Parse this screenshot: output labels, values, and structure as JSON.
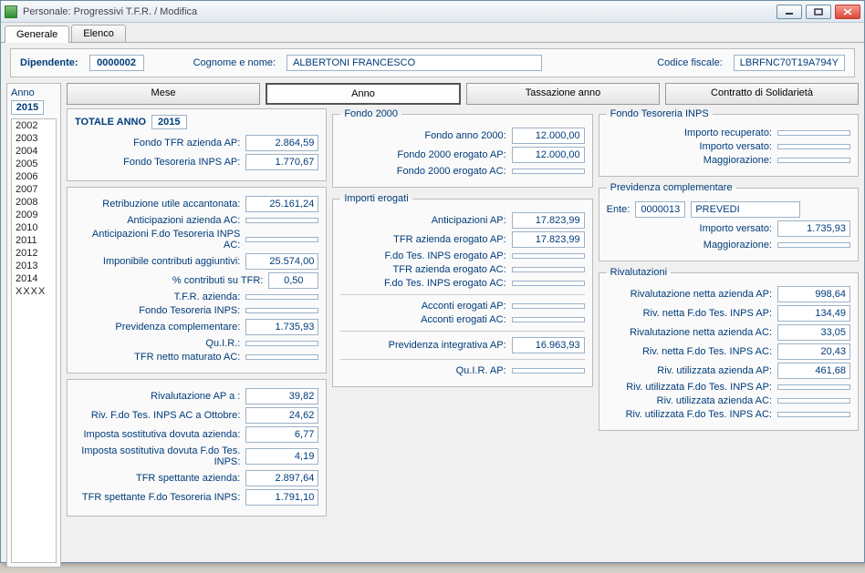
{
  "window": {
    "title": "Personale: Progressivi T.F.R. / Modifica"
  },
  "tabs": {
    "generale": "Generale",
    "elenco": "Elenco"
  },
  "header": {
    "dipendente_lbl": "Dipendente:",
    "dipendente_val": "0000002",
    "cognome_lbl": "Cognome e nome:",
    "cognome_val": "ALBERTONI FRANCESCO",
    "cf_lbl": "Codice fiscale:",
    "cf_val": "LBRFNC70T19A794Y"
  },
  "anno": {
    "label": "Anno",
    "value": "2015"
  },
  "years": [
    "2002",
    "2003",
    "2004",
    "2005",
    "2006",
    "2007",
    "2008",
    "2009",
    "2010",
    "2011",
    "2012",
    "2013",
    "2014"
  ],
  "years_edit_placeholder": "XXXX",
  "subtabs": {
    "mese": "Mese",
    "anno": "Anno",
    "tass": "Tassazione anno",
    "contratto": "Contratto di Solidarietà"
  },
  "totale_anno": {
    "label": "TOTALE ANNO",
    "year": "2015"
  },
  "col1a": {
    "fondo_tfr_az_ap": {
      "lab": "Fondo TFR azienda AP:",
      "val": "2.864,59"
    },
    "fondo_tes_inps_ap": {
      "lab": "Fondo Tesoreria INPS AP:",
      "val": "1.770,67"
    }
  },
  "col1b": {
    "retrib": {
      "lab": "Retribuzione utile accantonata:",
      "val": "25.161,24"
    },
    "anticip_az_ac": {
      "lab": "Anticipazioni azienda AC:",
      "val": ""
    },
    "anticip_fdo_ac": {
      "lab": "Anticipazioni F.do Tesoreria INPS AC:",
      "val": ""
    },
    "impon_contr": {
      "lab": "Imponibile contributi aggiuntivi:",
      "val": "25.574,00"
    },
    "perc_contr": {
      "lab": "% contributi su TFR:",
      "val": "0,50"
    },
    "tfr_az": {
      "lab": "T.F.R. azienda:",
      "val": ""
    },
    "fondo_tes_inps": {
      "lab": "Fondo Tesoreria INPS:",
      "val": ""
    },
    "prev_compl": {
      "lab": "Previdenza complementare:",
      "val": "1.735,93"
    },
    "quir": {
      "lab": "Qu.I.R.:",
      "val": ""
    },
    "tfr_netto": {
      "lab": "TFR netto maturato AC:",
      "val": ""
    }
  },
  "col1c": {
    "riv_ap": {
      "lab": "Rivalutazione AP a :",
      "val": "39,82"
    },
    "riv_fdo_ac_ott": {
      "lab": "Riv. F.do Tes. INPS AC a Ottobre:",
      "val": "24,62"
    },
    "imp_sost_az": {
      "lab": "Imposta sostitutiva dovuta azienda:",
      "val": "6,77"
    },
    "imp_sost_fdo": {
      "lab": "Imposta sostitutiva dovuta F.do Tes. INPS:",
      "val": "4,19"
    },
    "tfr_spett_az": {
      "lab": "TFR spettante azienda:",
      "val": "2.897,64"
    },
    "tfr_spett_fdo": {
      "lab": "TFR spettante F.do Tesoreria INPS:",
      "val": "1.791,10"
    }
  },
  "fondo2000": {
    "legend": "Fondo 2000",
    "a": {
      "lab": "Fondo anno 2000:",
      "val": "12.000,00"
    },
    "b": {
      "lab": "Fondo 2000 erogato AP:",
      "val": "12.000,00"
    },
    "c": {
      "lab": "Fondo 2000 erogato AC:",
      "val": ""
    }
  },
  "importi": {
    "legend": "Importi erogati",
    "anticip_ap": {
      "lab": "Anticipazioni AP:",
      "val": "17.823,99"
    },
    "tfr_az_ap": {
      "lab": "TFR azienda erogato AP:",
      "val": "17.823,99"
    },
    "fdo_tes_ap": {
      "lab": "F.do Tes. INPS erogato AP:",
      "val": ""
    },
    "tfr_az_ac": {
      "lab": "TFR azienda erogato AC:",
      "val": ""
    },
    "fdo_tes_ac": {
      "lab": "F.do Tes. INPS erogato AC:",
      "val": ""
    },
    "acc_ap": {
      "lab": "Acconti erogati AP:",
      "val": ""
    },
    "acc_ac": {
      "lab": "Acconti erogati AC:",
      "val": ""
    },
    "prev_int_ap": {
      "lab": "Previdenza integrativa AP:",
      "val": "16.963,93"
    },
    "quir_ap": {
      "lab": "Qu.I.R. AP:",
      "val": ""
    }
  },
  "fondo_tes_inps": {
    "legend": "Fondo Tesoreria INPS",
    "rec": {
      "lab": "Importo recuperato:",
      "val": ""
    },
    "vers": {
      "lab": "Importo versato:",
      "val": ""
    },
    "magg": {
      "lab": "Maggiorazione:",
      "val": ""
    }
  },
  "prev_compl": {
    "legend": "Previdenza complementare",
    "ente_lbl": "Ente:",
    "ente_code": "0000013",
    "ente_name": "PREVEDI",
    "vers": {
      "lab": "Importo versato:",
      "val": "1.735,93"
    },
    "magg": {
      "lab": "Maggiorazione:",
      "val": ""
    }
  },
  "rivalutazioni": {
    "legend": "Rivalutazioni",
    "a": {
      "lab": "Rivalutazione netta azienda AP:",
      "val": "998,64"
    },
    "b": {
      "lab": "Riv. netta F.do Tes. INPS AP:",
      "val": "134,49"
    },
    "c": {
      "lab": "Rivalutazione netta azienda AC:",
      "val": "33,05"
    },
    "d": {
      "lab": "Riv. netta F.do Tes. INPS AC:",
      "val": "20,43"
    },
    "e": {
      "lab": "Riv. utilizzata azienda AP:",
      "val": "461,68"
    },
    "f": {
      "lab": "Riv. utilizzata F.do Tes. INPS AP:",
      "val": ""
    },
    "g": {
      "lab": "Riv. utilizzata azienda AC:",
      "val": ""
    },
    "h": {
      "lab": "Riv. utilizzata F.do Tes. INPS AC:",
      "val": ""
    }
  }
}
